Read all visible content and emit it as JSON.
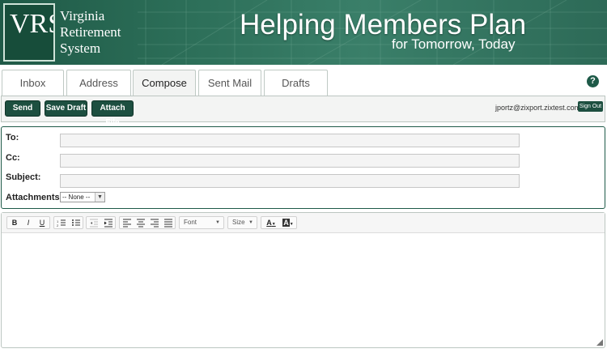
{
  "header": {
    "logo_letters": "VRS",
    "org_name_lines": [
      "Virginia",
      "Retirement",
      "System"
    ],
    "tagline_main": "Helping Members Plan",
    "tagline_sub": "for Tomorrow, Today"
  },
  "tabs": [
    {
      "label": "Inbox",
      "active": false
    },
    {
      "label": "Address",
      "active": false
    },
    {
      "label": "Compose",
      "active": true
    },
    {
      "label": "Sent Mail",
      "active": false
    },
    {
      "label": "Drafts",
      "active": false
    }
  ],
  "help_label": "?",
  "toolbar": {
    "send_label": "Send",
    "save_draft_label": "Save Draft",
    "attach_file_label": "Attach File",
    "user_email": "jportz@zixport.zixtest.com",
    "sign_out_label": "Sign Out"
  },
  "form": {
    "to_label": "To:",
    "cc_label": "Cc:",
    "subject_label": "Subject:",
    "attachments_label": "Attachments:",
    "to_value": "",
    "cc_value": "",
    "subject_value": "",
    "attachments_selected": "-- None --"
  },
  "editor": {
    "font_combo": "Font",
    "size_combo": "Size",
    "bold": "B",
    "italic": "I",
    "underline": "U",
    "text_color_glyph": "A",
    "bg_color_glyph": "A"
  },
  "colors": {
    "brand_dark": "#1d4f40",
    "banner": "#2c6e58"
  }
}
